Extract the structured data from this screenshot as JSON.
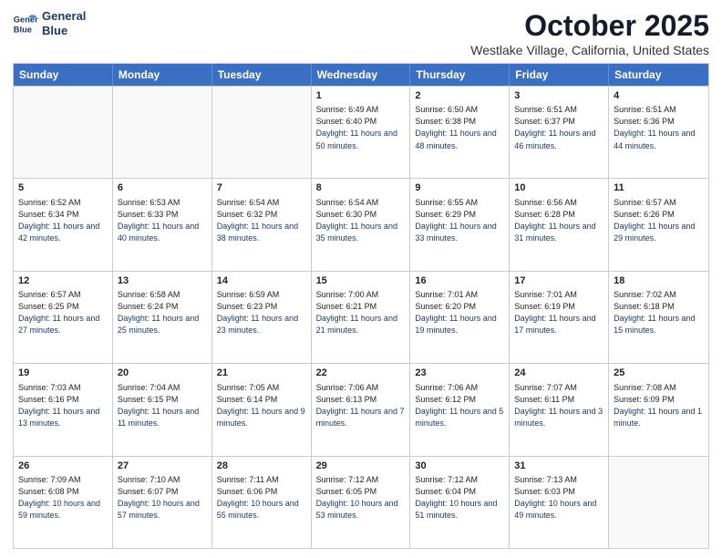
{
  "header": {
    "logo_line1": "General",
    "logo_line2": "Blue",
    "month": "October 2025",
    "location": "Westlake Village, California, United States"
  },
  "weekdays": [
    "Sunday",
    "Monday",
    "Tuesday",
    "Wednesday",
    "Thursday",
    "Friday",
    "Saturday"
  ],
  "rows": [
    [
      {
        "day": "",
        "sunrise": "",
        "sunset": "",
        "daylight": ""
      },
      {
        "day": "",
        "sunrise": "",
        "sunset": "",
        "daylight": ""
      },
      {
        "day": "",
        "sunrise": "",
        "sunset": "",
        "daylight": ""
      },
      {
        "day": "1",
        "sunrise": "Sunrise: 6:49 AM",
        "sunset": "Sunset: 6:40 PM",
        "daylight": "Daylight: 11 hours and 50 minutes."
      },
      {
        "day": "2",
        "sunrise": "Sunrise: 6:50 AM",
        "sunset": "Sunset: 6:38 PM",
        "daylight": "Daylight: 11 hours and 48 minutes."
      },
      {
        "day": "3",
        "sunrise": "Sunrise: 6:51 AM",
        "sunset": "Sunset: 6:37 PM",
        "daylight": "Daylight: 11 hours and 46 minutes."
      },
      {
        "day": "4",
        "sunrise": "Sunrise: 6:51 AM",
        "sunset": "Sunset: 6:36 PM",
        "daylight": "Daylight: 11 hours and 44 minutes."
      }
    ],
    [
      {
        "day": "5",
        "sunrise": "Sunrise: 6:52 AM",
        "sunset": "Sunset: 6:34 PM",
        "daylight": "Daylight: 11 hours and 42 minutes."
      },
      {
        "day": "6",
        "sunrise": "Sunrise: 6:53 AM",
        "sunset": "Sunset: 6:33 PM",
        "daylight": "Daylight: 11 hours and 40 minutes."
      },
      {
        "day": "7",
        "sunrise": "Sunrise: 6:54 AM",
        "sunset": "Sunset: 6:32 PM",
        "daylight": "Daylight: 11 hours and 38 minutes."
      },
      {
        "day": "8",
        "sunrise": "Sunrise: 6:54 AM",
        "sunset": "Sunset: 6:30 PM",
        "daylight": "Daylight: 11 hours and 35 minutes."
      },
      {
        "day": "9",
        "sunrise": "Sunrise: 6:55 AM",
        "sunset": "Sunset: 6:29 PM",
        "daylight": "Daylight: 11 hours and 33 minutes."
      },
      {
        "day": "10",
        "sunrise": "Sunrise: 6:56 AM",
        "sunset": "Sunset: 6:28 PM",
        "daylight": "Daylight: 11 hours and 31 minutes."
      },
      {
        "day": "11",
        "sunrise": "Sunrise: 6:57 AM",
        "sunset": "Sunset: 6:26 PM",
        "daylight": "Daylight: 11 hours and 29 minutes."
      }
    ],
    [
      {
        "day": "12",
        "sunrise": "Sunrise: 6:57 AM",
        "sunset": "Sunset: 6:25 PM",
        "daylight": "Daylight: 11 hours and 27 minutes."
      },
      {
        "day": "13",
        "sunrise": "Sunrise: 6:58 AM",
        "sunset": "Sunset: 6:24 PM",
        "daylight": "Daylight: 11 hours and 25 minutes."
      },
      {
        "day": "14",
        "sunrise": "Sunrise: 6:59 AM",
        "sunset": "Sunset: 6:23 PM",
        "daylight": "Daylight: 11 hours and 23 minutes."
      },
      {
        "day": "15",
        "sunrise": "Sunrise: 7:00 AM",
        "sunset": "Sunset: 6:21 PM",
        "daylight": "Daylight: 11 hours and 21 minutes."
      },
      {
        "day": "16",
        "sunrise": "Sunrise: 7:01 AM",
        "sunset": "Sunset: 6:20 PM",
        "daylight": "Daylight: 11 hours and 19 minutes."
      },
      {
        "day": "17",
        "sunrise": "Sunrise: 7:01 AM",
        "sunset": "Sunset: 6:19 PM",
        "daylight": "Daylight: 11 hours and 17 minutes."
      },
      {
        "day": "18",
        "sunrise": "Sunrise: 7:02 AM",
        "sunset": "Sunset: 6:18 PM",
        "daylight": "Daylight: 11 hours and 15 minutes."
      }
    ],
    [
      {
        "day": "19",
        "sunrise": "Sunrise: 7:03 AM",
        "sunset": "Sunset: 6:16 PM",
        "daylight": "Daylight: 11 hours and 13 minutes."
      },
      {
        "day": "20",
        "sunrise": "Sunrise: 7:04 AM",
        "sunset": "Sunset: 6:15 PM",
        "daylight": "Daylight: 11 hours and 11 minutes."
      },
      {
        "day": "21",
        "sunrise": "Sunrise: 7:05 AM",
        "sunset": "Sunset: 6:14 PM",
        "daylight": "Daylight: 11 hours and 9 minutes."
      },
      {
        "day": "22",
        "sunrise": "Sunrise: 7:06 AM",
        "sunset": "Sunset: 6:13 PM",
        "daylight": "Daylight: 11 hours and 7 minutes."
      },
      {
        "day": "23",
        "sunrise": "Sunrise: 7:06 AM",
        "sunset": "Sunset: 6:12 PM",
        "daylight": "Daylight: 11 hours and 5 minutes."
      },
      {
        "day": "24",
        "sunrise": "Sunrise: 7:07 AM",
        "sunset": "Sunset: 6:11 PM",
        "daylight": "Daylight: 11 hours and 3 minutes."
      },
      {
        "day": "25",
        "sunrise": "Sunrise: 7:08 AM",
        "sunset": "Sunset: 6:09 PM",
        "daylight": "Daylight: 11 hours and 1 minute."
      }
    ],
    [
      {
        "day": "26",
        "sunrise": "Sunrise: 7:09 AM",
        "sunset": "Sunset: 6:08 PM",
        "daylight": "Daylight: 10 hours and 59 minutes."
      },
      {
        "day": "27",
        "sunrise": "Sunrise: 7:10 AM",
        "sunset": "Sunset: 6:07 PM",
        "daylight": "Daylight: 10 hours and 57 minutes."
      },
      {
        "day": "28",
        "sunrise": "Sunrise: 7:11 AM",
        "sunset": "Sunset: 6:06 PM",
        "daylight": "Daylight: 10 hours and 55 minutes."
      },
      {
        "day": "29",
        "sunrise": "Sunrise: 7:12 AM",
        "sunset": "Sunset: 6:05 PM",
        "daylight": "Daylight: 10 hours and 53 minutes."
      },
      {
        "day": "30",
        "sunrise": "Sunrise: 7:12 AM",
        "sunset": "Sunset: 6:04 PM",
        "daylight": "Daylight: 10 hours and 51 minutes."
      },
      {
        "day": "31",
        "sunrise": "Sunrise: 7:13 AM",
        "sunset": "Sunset: 6:03 PM",
        "daylight": "Daylight: 10 hours and 49 minutes."
      },
      {
        "day": "",
        "sunrise": "",
        "sunset": "",
        "daylight": ""
      }
    ]
  ]
}
